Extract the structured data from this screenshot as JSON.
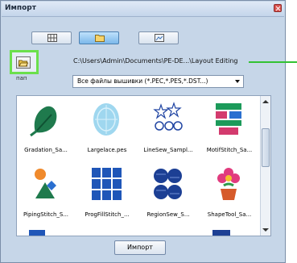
{
  "window": {
    "title": "Импорт",
    "close_icon": "close-icon"
  },
  "view_toolbar": {
    "buttons": [
      {
        "icon": "thumbnail-grid-icon",
        "active": false
      },
      {
        "icon": "folder-icon",
        "active": true
      },
      {
        "icon": "preview-icon",
        "active": false
      }
    ]
  },
  "folder_button": {
    "icon": "open-folder-icon",
    "caption": "пап"
  },
  "path": {
    "text": "C:\\Users\\Admin\\Documents\\PE-DE...\\Layout  Editing"
  },
  "filter": {
    "value": "Все файлы вышивки (*.PEC,*.PES,*.DST...)"
  },
  "files": [
    {
      "name": "Gradation_Sa...",
      "icon": "leaf-embroidery-icon"
    },
    {
      "name": "Largelace.pes",
      "icon": "lace-oval-icon"
    },
    {
      "name": "LineSew_Sampl...",
      "icon": "line-stars-icon"
    },
    {
      "name": "MotifStitch_Sa...",
      "icon": "motif-stitch-icon"
    },
    {
      "name": "PipingStitch_S...",
      "icon": "piping-stitch-icon"
    },
    {
      "name": "ProgFillStitch_...",
      "icon": "prog-fill-icon"
    },
    {
      "name": "RegionSew_S...",
      "icon": "region-sew-icon"
    },
    {
      "name": "ShapeTool_Sa...",
      "icon": "flower-pot-icon"
    }
  ],
  "actions": {
    "import_label": "Импорт"
  },
  "colors": {
    "window_bg": "#c6d6e8",
    "highlight_green": "#6be04c",
    "selected_button": "#7cb8ea"
  }
}
